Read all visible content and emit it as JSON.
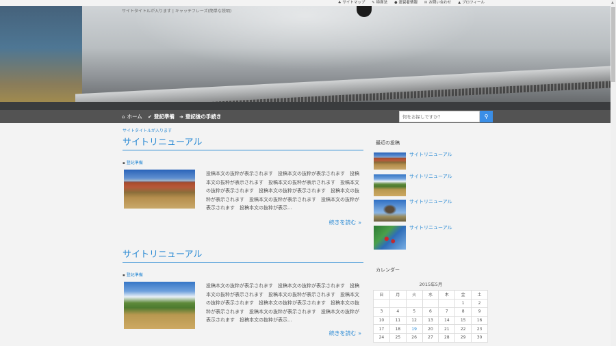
{
  "topbar": {
    "links": [
      {
        "icon": "sitemap-icon",
        "glyph": "♣",
        "label": "サイトマップ"
      },
      {
        "icon": "wrench-icon",
        "glyph": "✎",
        "label": "特商法"
      },
      {
        "icon": "info-icon",
        "glyph": "●",
        "label": "運営者情報"
      },
      {
        "icon": "mail-icon",
        "glyph": "✉",
        "label": "お問い合わせ"
      },
      {
        "icon": "user-icon",
        "glyph": "▲",
        "label": "プロフィール"
      }
    ]
  },
  "header": {
    "site_caption": "サイトタイトルが入ります | キャッチフレーズ(簡単な説明)"
  },
  "nav": {
    "items": [
      {
        "icon": "home-icon",
        "glyph": "⌂",
        "label": "ホーム"
      },
      {
        "icon": "check-icon",
        "glyph": "✔",
        "label": "登記準備"
      },
      {
        "icon": "arrow-right-icon",
        "glyph": "➜",
        "label": "登記後の手続き"
      }
    ],
    "search_placeholder": "何をお探しですか？",
    "search_button_glyph": "⚲"
  },
  "main": {
    "breadcrumb": "サイトタイトルが入ります",
    "posts": [
      {
        "title": "サイトリニューアル",
        "category": "登記準備",
        "category_glyph": "▪",
        "excerpt": "投稿本文の抜粋が表示されます　投稿本文の抜粋が表示されます　投稿本文の抜粋が表示されます　投稿本文の抜粋が表示されます　投稿本文の抜粋が表示されます　投稿本文の抜粋が表示されます　投稿本文の抜粋が表示されます　投稿本文の抜粋が表示されます　投稿本文の抜粋が表示されます　投稿本文の抜粋が表示...",
        "read_more": "続きを読む »"
      },
      {
        "title": "サイトリニューアル",
        "category": "登記準備",
        "category_glyph": "▪",
        "excerpt": "投稿本文の抜粋が表示されます　投稿本文の抜粋が表示されます　投稿本文の抜粋が表示されます　投稿本文の抜粋が表示されます　投稿本文の抜粋が表示されます　投稿本文の抜粋が表示されます　投稿本文の抜粋が表示されます　投稿本文の抜粋が表示されます　投稿本文の抜粋が表示されます　投稿本文の抜粋が表示...",
        "read_more": "続きを読む »"
      }
    ]
  },
  "sidebar": {
    "recent_heading": "最近の投稿",
    "recent_posts": [
      {
        "title": "サイトリニューアル"
      },
      {
        "title": "サイトリニューアル"
      },
      {
        "title": "サイトリニューアル"
      },
      {
        "title": "サイトリニューアル"
      }
    ],
    "calendar_heading": "カレンダー",
    "calendar": {
      "caption": "2015年5月",
      "weekdays": [
        "日",
        "月",
        "火",
        "水",
        "木",
        "金",
        "土"
      ],
      "rows": [
        [
          "",
          "",
          "",
          "",
          "",
          "1",
          "2"
        ],
        [
          "3",
          "4",
          "5",
          "6",
          "7",
          "8",
          "9"
        ],
        [
          "10",
          "11",
          "12",
          "13",
          "14",
          "15",
          "16"
        ],
        [
          "17",
          "18",
          "19",
          "20",
          "21",
          "22",
          "23"
        ],
        [
          "24",
          "25",
          "26",
          "27",
          "28",
          "29",
          "30"
        ]
      ],
      "linked_day": "19"
    }
  }
}
